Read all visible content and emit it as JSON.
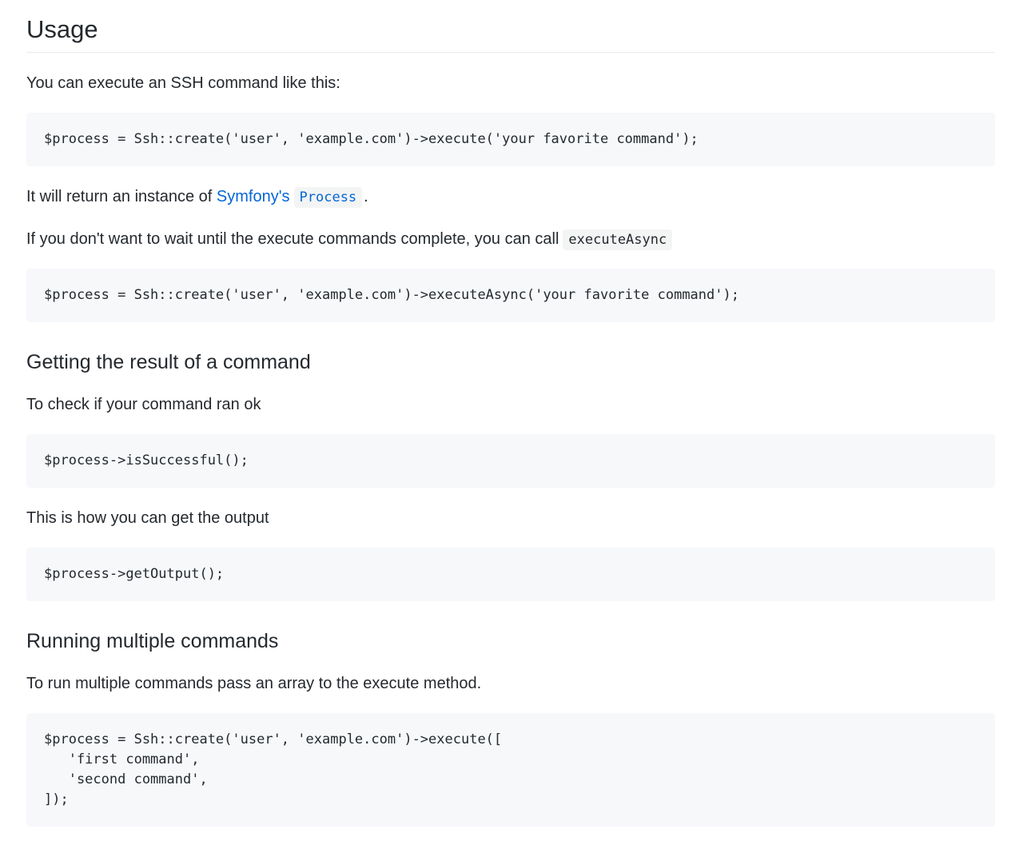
{
  "usage": {
    "title": "Usage",
    "intro": "You can execute an SSH command like this:",
    "code_execute": "$process = Ssh::create('user', 'example.com')->execute('your favorite command');",
    "return_prefix": "It will return an instance of ",
    "return_link": "Symfony's",
    "return_code": "Process",
    "return_suffix": ".",
    "async_text": "If you don't want to wait until the execute commands complete, you can call",
    "async_code_inline": "executeAsync",
    "code_async": "$process = Ssh::create('user', 'example.com')->executeAsync('your favorite command');"
  },
  "result": {
    "title": "Getting the result of a command",
    "check_text": "To check if your command ran ok",
    "code_success": "$process->isSuccessful();",
    "output_text": "This is how you can get the output",
    "code_output": "$process->getOutput();"
  },
  "multiple": {
    "title": "Running multiple commands",
    "text": "To run multiple commands pass an array to the execute method.",
    "code": "$process = Ssh::create('user', 'example.com')->execute([\n   'first command',\n   'second command',\n]);"
  }
}
